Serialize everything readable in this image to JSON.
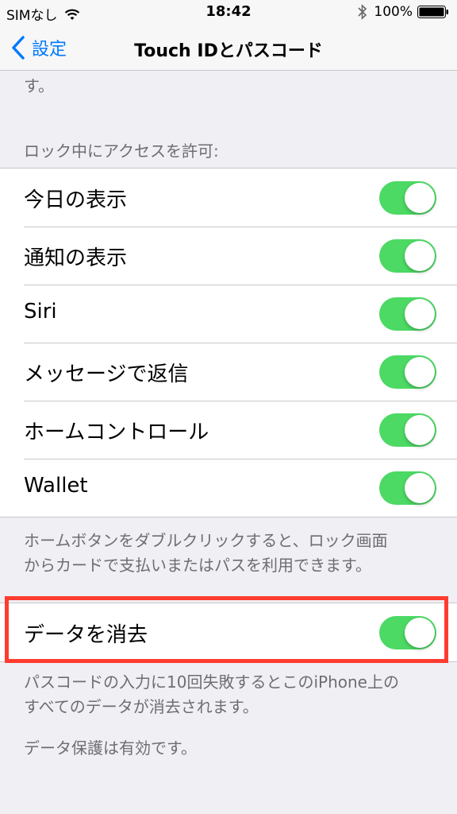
{
  "status_bar": {
    "carrier": "SIMなし",
    "time": "18:42",
    "battery": "100%"
  },
  "nav": {
    "back_label": "設定",
    "title": "Touch IDとパスコード"
  },
  "truncated_text": "す。",
  "lock_access": {
    "header": "ロック中にアクセスを許可:",
    "items": [
      {
        "label": "今日の表示",
        "on": true
      },
      {
        "label": "通知の表示",
        "on": true
      },
      {
        "label": "Siri",
        "on": true
      },
      {
        "label": "メッセージで返信",
        "on": true
      },
      {
        "label": "ホームコントロール",
        "on": true
      },
      {
        "label": "Wallet",
        "on": true
      }
    ],
    "footer_line1": "ホームボタンをダブルクリックすると、ロック画面",
    "footer_line2": "からカードで支払いまたはパスを利用できます。"
  },
  "erase_data": {
    "label": "データを消去",
    "on": true,
    "footer_line1": "パスコードの入力に10回失敗するとこのiPhone上の",
    "footer_line2": "すべてのデータが消去されます。",
    "protection_note": "データ保護は有効です。"
  },
  "colors": {
    "accent": "#007aff",
    "toggle_on": "#4cd964",
    "highlight": "#ff3b30"
  }
}
